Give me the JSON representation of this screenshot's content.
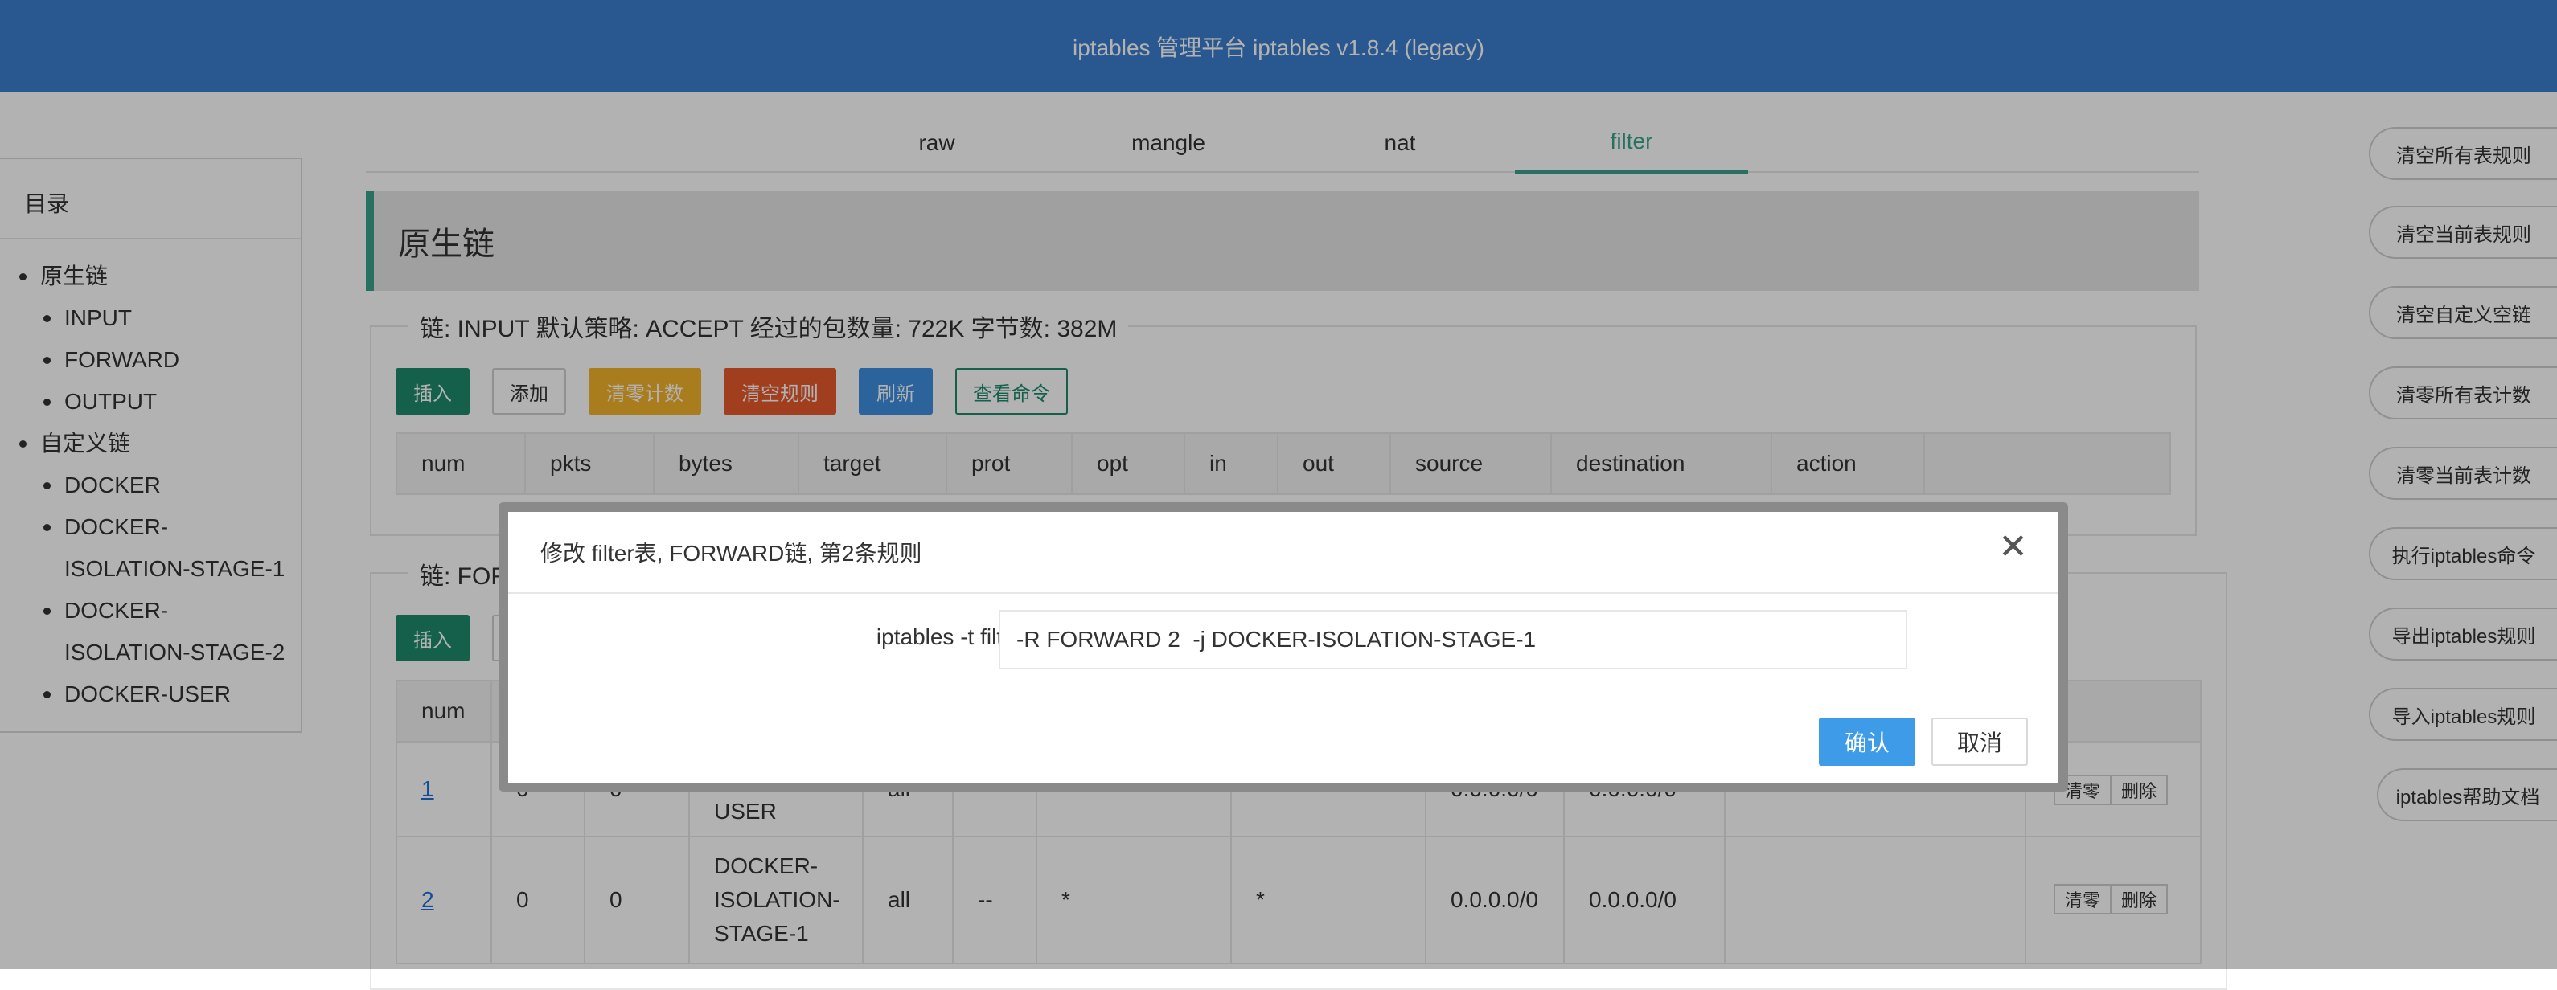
{
  "header": {
    "title": "iptables 管理平台 iptables v1.8.4 (legacy)"
  },
  "tabs": [
    {
      "label": "raw"
    },
    {
      "label": "mangle"
    },
    {
      "label": "nat"
    },
    {
      "label": "filter",
      "active": true
    }
  ],
  "sidebar": {
    "title": "目录",
    "items": [
      {
        "label": "原生链",
        "level": 0
      },
      {
        "label": "INPUT",
        "level": 1
      },
      {
        "label": "FORWARD",
        "level": 1
      },
      {
        "label": "OUTPUT",
        "level": 1
      },
      {
        "label": "自定义链",
        "level": 0
      },
      {
        "label": "DOCKER",
        "level": 1
      },
      {
        "label": "DOCKER-",
        "level": 1
      },
      {
        "label": "ISOLATION-STAGE-1",
        "level": 1,
        "continuation": true
      },
      {
        "label": "DOCKER-",
        "level": 1
      },
      {
        "label": "ISOLATION-STAGE-2",
        "level": 1,
        "continuation": true
      },
      {
        "label": "DOCKER-USER",
        "level": 1
      }
    ]
  },
  "section": {
    "title": "原生链"
  },
  "input_chain": {
    "legend": "链: INPUT  默认策略: ACCEPT  经过的包数量: 722K  字节数: 382M",
    "buttons": [
      "插入",
      "添加",
      "清零计数",
      "清空规则",
      "刷新",
      "查看命令"
    ],
    "columns": [
      "num",
      "pkts",
      "bytes",
      "target",
      "prot",
      "opt",
      "in",
      "out",
      "source",
      "destination",
      "action"
    ]
  },
  "forward_chain": {
    "legend": "链: FOR",
    "insert_label": "插入",
    "num_header": "num",
    "rows": [
      {
        "num": "1",
        "pkts": "0",
        "bytes": "0",
        "target": "USER",
        "prot": "all",
        "opt": "--",
        "in": "*",
        "out": "*",
        "source": "0.0.0.0/0",
        "destination": "0.0.0.0/0",
        "clear": "清零",
        "delete": "删除"
      },
      {
        "num": "2",
        "pkts": "0",
        "bytes": "0",
        "target_lines": [
          "DOCKER-",
          "ISOLATION-",
          "STAGE-1"
        ],
        "prot": "all",
        "opt": "--",
        "in": "*",
        "out": "*",
        "source": "0.0.0.0/0",
        "destination": "0.0.0.0/0",
        "clear": "清零",
        "delete": "删除"
      }
    ]
  },
  "right_actions": [
    "清空所有表规则",
    "清空当前表规则",
    "清空自定义空链",
    "清零所有表计数",
    "清零当前表计数",
    "执行iptables命令",
    "导出iptables规则",
    "导入iptables规则",
    "iptables帮助文档"
  ],
  "modal": {
    "title": "修改 filter表, FORWARD链, 第2条规则",
    "label": "iptables -t filter",
    "input_value": "-R FORWARD 2  -j DOCKER-ISOLATION-STAGE-1",
    "confirm": "确认",
    "cancel": "取消",
    "close_icon": "close-icon"
  }
}
